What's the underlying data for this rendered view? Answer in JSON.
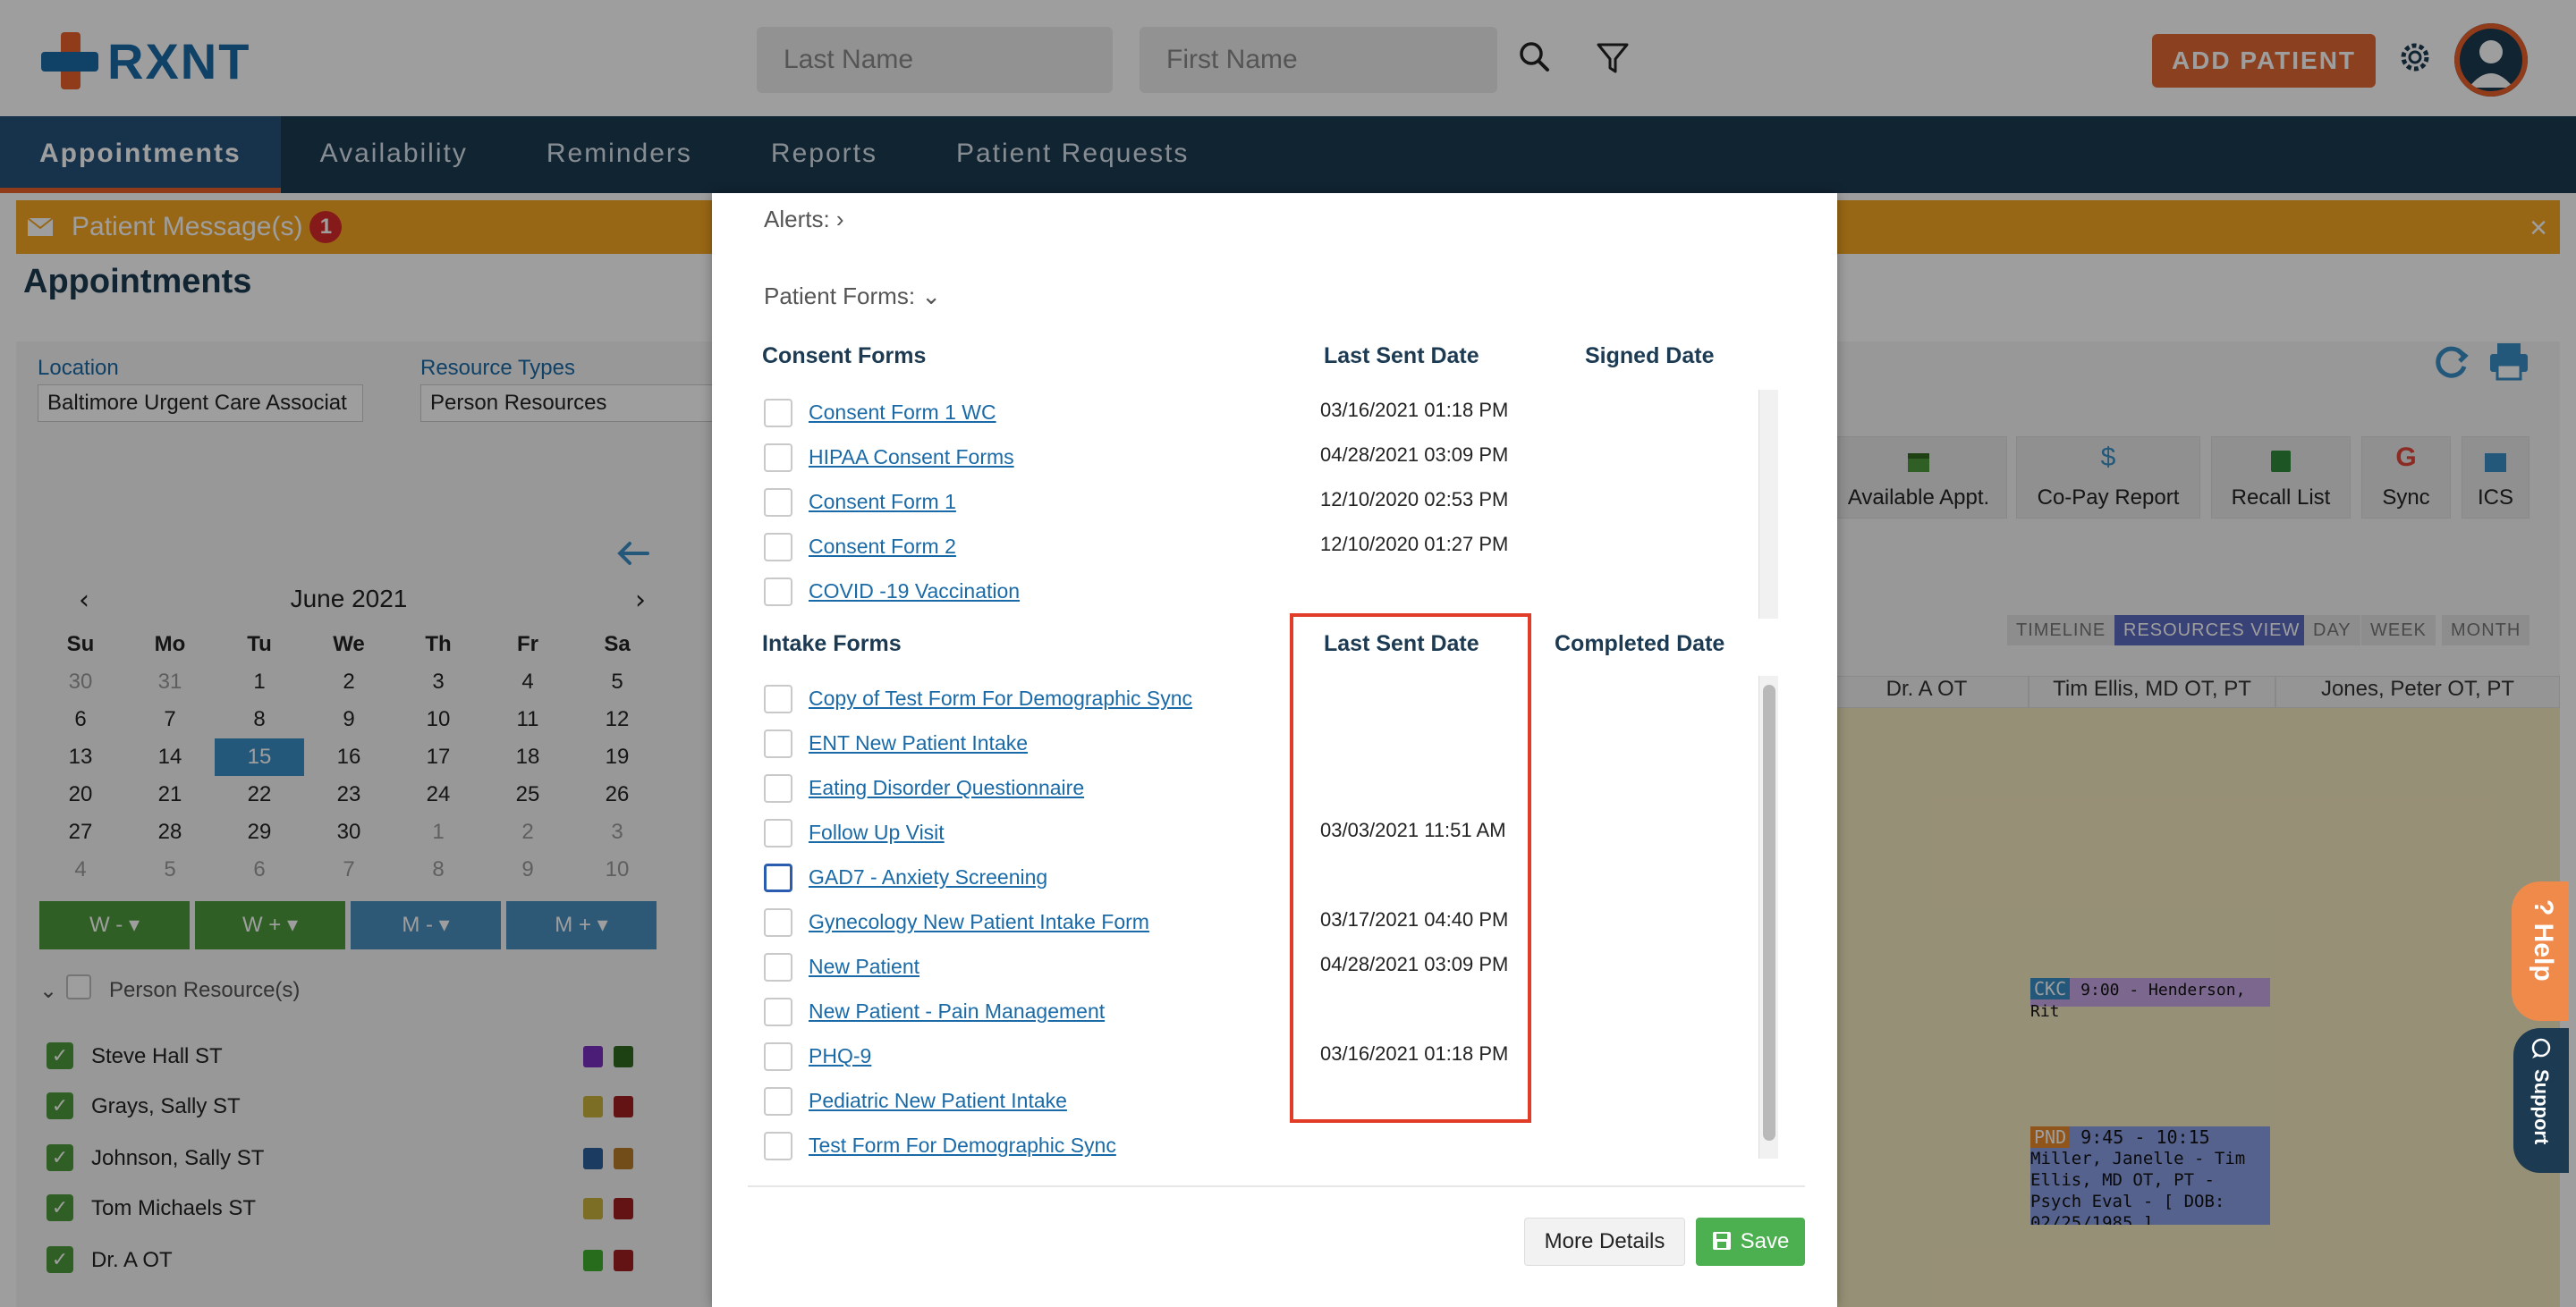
{
  "app": {
    "logo_text": "RXNT"
  },
  "header": {
    "last_name_placeholder": "Last Name",
    "first_name_placeholder": "First Name",
    "add_patient_label": "ADD PATIENT"
  },
  "nav": {
    "items": [
      "Appointments",
      "Availability",
      "Reminders",
      "Reports",
      "Patient Requests"
    ],
    "active": "Appointments"
  },
  "message_bar": {
    "label": "Patient Message(s)",
    "count": "1",
    "close": "×"
  },
  "page_title": "Appointments",
  "filters": {
    "location_label": "Location",
    "location_value": "Baltimore Urgent Care Associat",
    "resource_types_label": "Resource Types",
    "resource_types_value": "Person Resources"
  },
  "calendar": {
    "month": "June 2021",
    "weekdays": [
      "Su",
      "Mo",
      "Tu",
      "We",
      "Th",
      "Fr",
      "Sa"
    ],
    "selected_day": "15",
    "weeks": [
      [
        "30",
        "31",
        "1",
        "2",
        "3",
        "4",
        "5"
      ],
      [
        "6",
        "7",
        "8",
        "9",
        "10",
        "11",
        "12"
      ],
      [
        "13",
        "14",
        "15",
        "16",
        "17",
        "18",
        "19"
      ],
      [
        "20",
        "21",
        "22",
        "23",
        "24",
        "25",
        "26"
      ],
      [
        "27",
        "28",
        "29",
        "30",
        "1",
        "2",
        "3"
      ],
      [
        "4",
        "5",
        "6",
        "7",
        "8",
        "9",
        "10"
      ]
    ]
  },
  "week_buttons": [
    "W -",
    "W +",
    "M -",
    "M +"
  ],
  "resources": {
    "header": "Person Resource(s)",
    "items": [
      "Steve Hall ST",
      "Grays, Sally ST",
      "Johnson, Sally ST",
      "Tom Michaels ST",
      "Dr. A OT"
    ]
  },
  "toolbar": {
    "buttons": [
      "Available Appt.",
      "Co-Pay Report",
      "Recall List",
      "Sync",
      "ICS"
    ]
  },
  "views": [
    "TIMELINE",
    "RESOURCES VIEW",
    "DAY",
    "WEEK",
    "MONTH"
  ],
  "schedule": {
    "columns": [
      "Dr. A OT",
      "Tim Ellis, MD OT, PT",
      "Jones, Peter OT, PT"
    ],
    "appt1": {
      "tag": "CKC",
      "text": "9:00 - Henderson, Rit"
    },
    "appt2": {
      "tag": "PND",
      "time": "9:45 - 10:15",
      "text": "Miller, Janelle - Tim Ellis, MD OT, PT - Psych Eval - [ DOB: 02/25/1985 ]"
    }
  },
  "modal": {
    "alerts_label": "Alerts:",
    "patient_forms_label": "Patient Forms:",
    "consent": {
      "title": "Consent Forms",
      "col_last_sent": "Last Sent Date",
      "col_signed": "Signed Date",
      "rows": [
        {
          "name": "Consent Form 1 WC",
          "last_sent": "03/16/2021 01:18 PM"
        },
        {
          "name": "HIPAA Consent Forms",
          "last_sent": "04/28/2021 03:09 PM"
        },
        {
          "name": "Consent Form 1",
          "last_sent": "12/10/2020 02:53 PM"
        },
        {
          "name": "Consent Form 2",
          "last_sent": "12/10/2020 01:27 PM"
        },
        {
          "name": "COVID -19 Vaccination",
          "last_sent": ""
        }
      ]
    },
    "intake": {
      "title": "Intake Forms",
      "col_last_sent": "Last Sent Date",
      "col_completed": "Completed Date",
      "rows": [
        {
          "name": "Copy of Test Form For Demographic Sync",
          "last_sent": ""
        },
        {
          "name": "ENT New Patient Intake",
          "last_sent": ""
        },
        {
          "name": "Eating Disorder Questionnaire",
          "last_sent": ""
        },
        {
          "name": "Follow Up Visit",
          "last_sent": "03/03/2021 11:51 AM"
        },
        {
          "name": "GAD7 - Anxiety Screening",
          "last_sent": ""
        },
        {
          "name": "Gynecology New Patient Intake Form",
          "last_sent": "03/17/2021 04:40 PM"
        },
        {
          "name": "New Patient",
          "last_sent": "04/28/2021 03:09 PM"
        },
        {
          "name": "New Patient - Pain Management",
          "last_sent": ""
        },
        {
          "name": "PHQ-9",
          "last_sent": "03/16/2021 01:18 PM"
        },
        {
          "name": "Pediatric New Patient Intake",
          "last_sent": ""
        },
        {
          "name": "Test Form For Demographic Sync",
          "last_sent": ""
        }
      ]
    },
    "more_details_label": "More Details",
    "save_label": "Save"
  },
  "widgets": {
    "help_label": "? Help",
    "support_label": "Support"
  },
  "colors": {
    "brand_blue": "#1a6aa7",
    "brand_orange": "#e8622c",
    "nav_bg": "#1c3a52",
    "save_green": "#4caf50",
    "highlight_red": "#e03c28"
  }
}
